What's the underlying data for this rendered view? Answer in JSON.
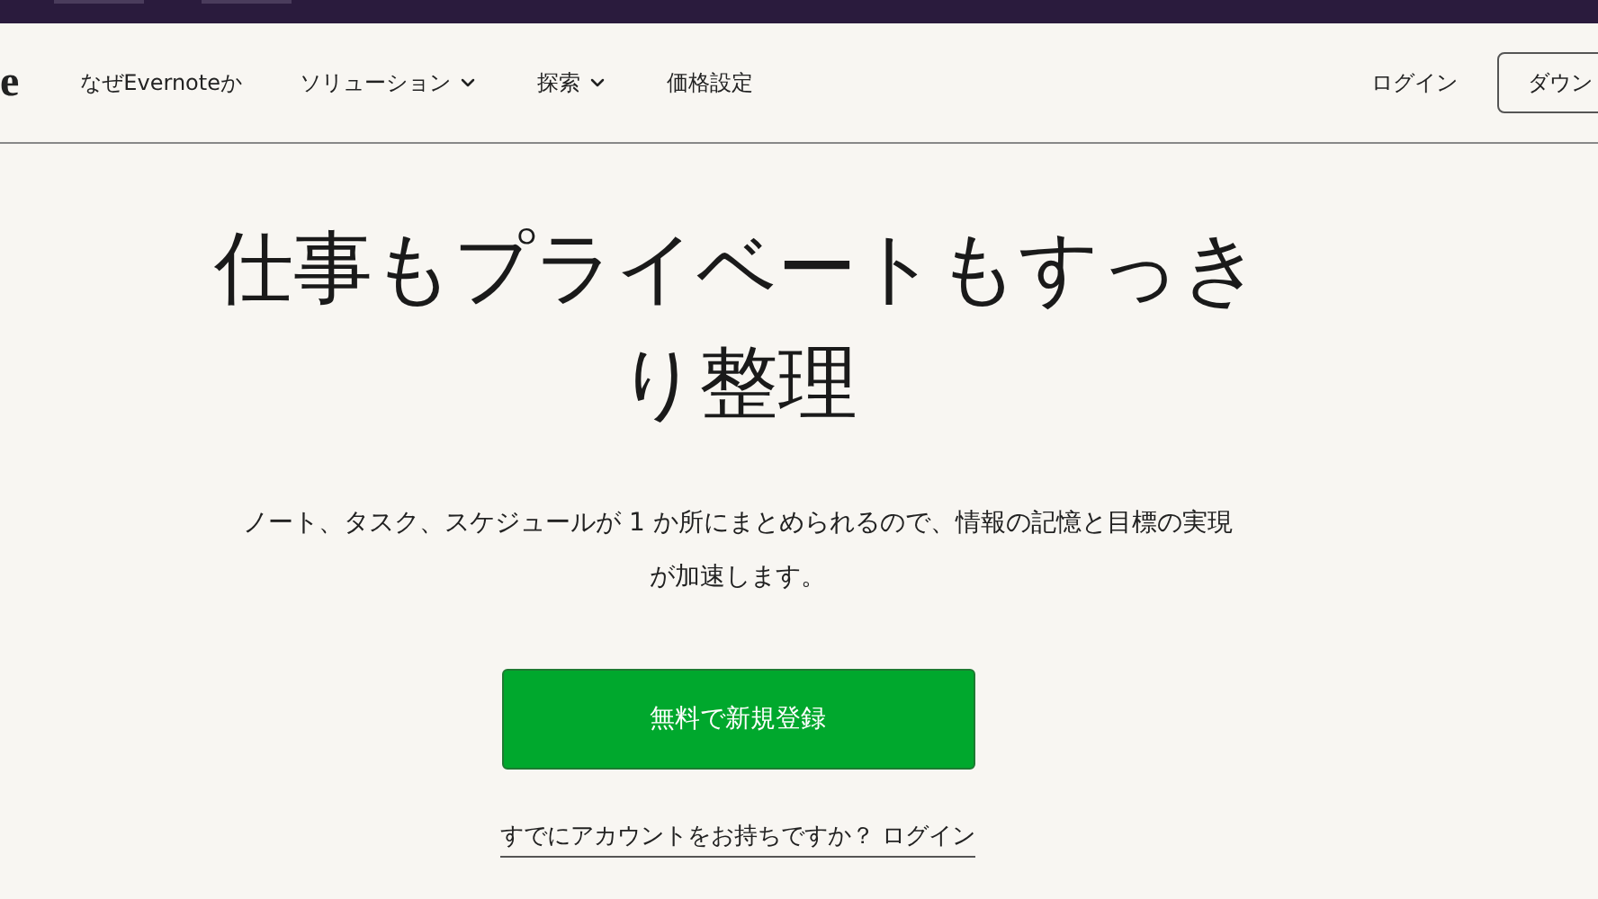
{
  "logo": "e",
  "nav": [
    {
      "label": "なぜEvernoteか",
      "dropdown": false
    },
    {
      "label": "ソリューション",
      "dropdown": true
    },
    {
      "label": "探索",
      "dropdown": true
    },
    {
      "label": "価格設定",
      "dropdown": false
    }
  ],
  "login": "ログイン",
  "download": "ダウン",
  "hero": {
    "title": "仕事もプライベートもすっきり整理",
    "text": "ノート、タスク、スケジュールが 1 か所にまとめられるので、情報の記憶と目標の実現が加速します。",
    "cta": "無料で新規登録",
    "signin": "すでにアカウントをお持ちですか？ ログイン"
  }
}
